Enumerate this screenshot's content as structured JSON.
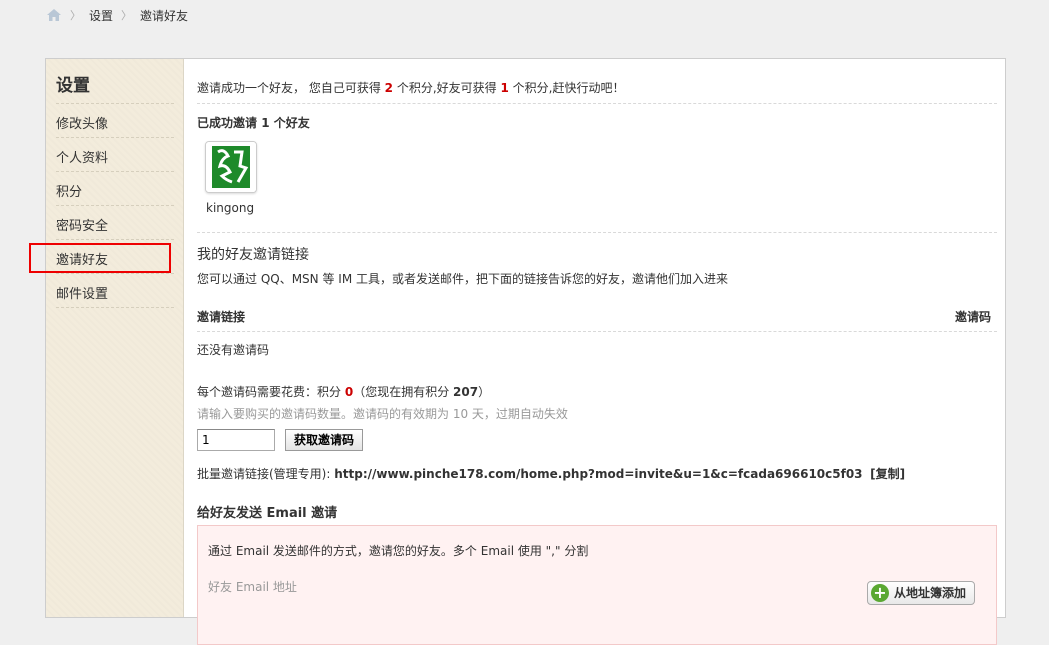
{
  "breadcrumb": {
    "items": [
      "设置",
      "邀请好友"
    ]
  },
  "sidebar": {
    "title": "设置",
    "items": [
      {
        "label": "修改头像"
      },
      {
        "label": "个人资料"
      },
      {
        "label": "积分"
      },
      {
        "label": "密码安全"
      },
      {
        "label": "邀请好友"
      },
      {
        "label": "邮件设置"
      }
    ],
    "active_item": "邀请好友"
  },
  "main": {
    "intro": {
      "prefix": "邀请成功一个好友，  您自己可获得 ",
      "self_points": "2",
      "mid": " 个积分,好友可获得 ",
      "friend_points": "1",
      "suffix": " 个积分,赶快行动吧！"
    },
    "success": {
      "prefix": "已成功邀请 ",
      "count": "1",
      "suffix": " 个好友"
    },
    "friend": {
      "name": "kingong"
    },
    "invite_link": {
      "title": "我的好友邀请链接",
      "desc": "您可以通过 QQ、MSN 等 IM 工具，或者发送邮件，把下面的链接告诉您的好友，邀请他们加入进来",
      "col_link": "邀请链接",
      "col_code": "邀请码",
      "empty": "还没有邀请码"
    },
    "cost": {
      "prefix": "每个邀请码需要花费：积分 ",
      "points": "0",
      "mid": "（您现在拥有积分 ",
      "owned": "207",
      "suffix": "）"
    },
    "hint": "请输入要购买的邀请码数量。邀请码的有效期为 10 天，过期自动失效",
    "qty_value": "1",
    "get_code_label": "获取邀请码",
    "batch": {
      "label": "批量邀请链接(管理专用): ",
      "url": "http://www.pinche178.com/home.php?mod=invite&u=1&c=fcada696610c5f03",
      "copy": "[复制]"
    },
    "email": {
      "title": "给好友发送 Email 邀请",
      "desc": "通过 Email 发送邮件的方式，邀请您的好友。多个 Email 使用 \",\" 分割",
      "addr_label": "好友 Email 地址",
      "add_button": "从地址簿添加"
    }
  }
}
